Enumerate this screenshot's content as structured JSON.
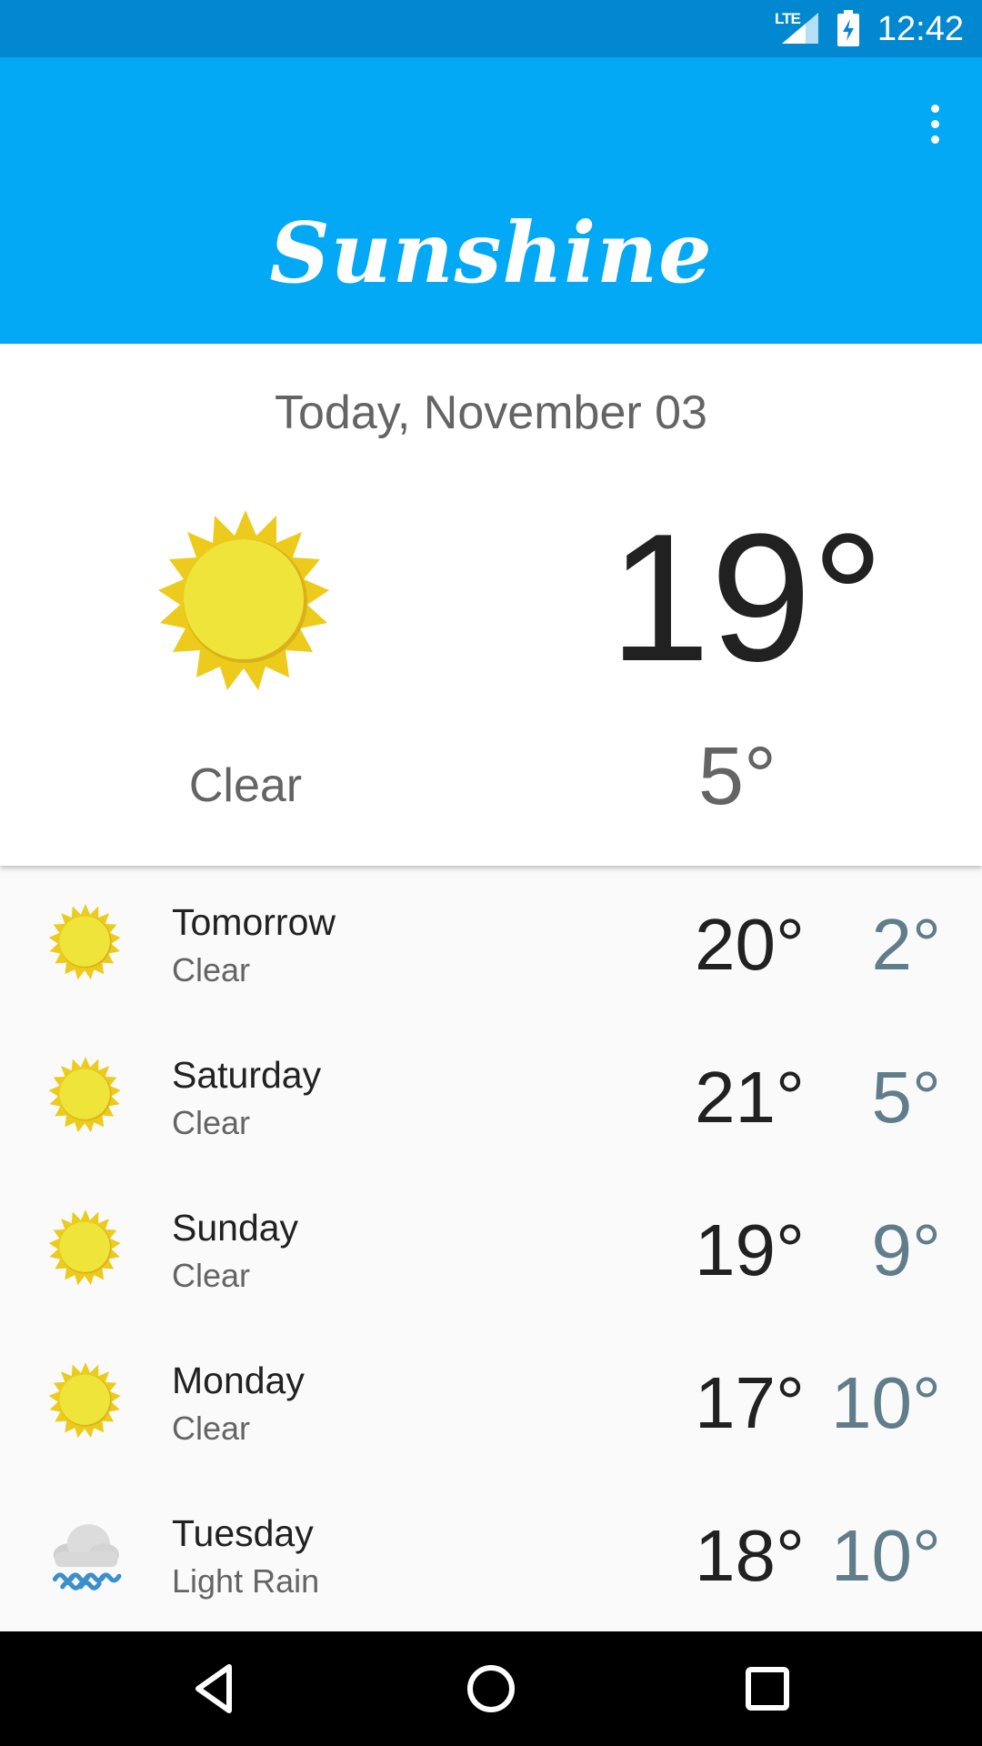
{
  "status_bar": {
    "network": "LTE",
    "time": "12:42",
    "icons": [
      "lte-signal-icon",
      "battery-charging-icon"
    ]
  },
  "app_bar": {
    "title": "Sunshine",
    "menu_icon": "overflow-menu-icon"
  },
  "today": {
    "date": "Today, November 03",
    "high": "19°",
    "low": "5°",
    "description": "Clear",
    "icon": "sun-icon"
  },
  "forecast": [
    {
      "day": "Tomorrow",
      "description": "Clear",
      "high": "20°",
      "low": "2°",
      "icon": "sun-icon"
    },
    {
      "day": "Saturday",
      "description": "Clear",
      "high": "21°",
      "low": "5°",
      "icon": "sun-icon"
    },
    {
      "day": "Sunday",
      "description": "Clear",
      "high": "19°",
      "low": "9°",
      "icon": "sun-icon"
    },
    {
      "day": "Monday",
      "description": "Clear",
      "high": "17°",
      "low": "10°",
      "icon": "sun-icon"
    },
    {
      "day": "Tuesday",
      "description": "Light Rain",
      "high": "18°",
      "low": "10°",
      "icon": "rain-cloud-icon"
    }
  ],
  "nav_bar": {
    "buttons": [
      "back-icon",
      "home-icon",
      "recents-icon"
    ]
  },
  "colors": {
    "status_bar": "#0288d1",
    "primary": "#03a9f4",
    "low_temp": "#607d8b",
    "sun": "#f1e338"
  }
}
